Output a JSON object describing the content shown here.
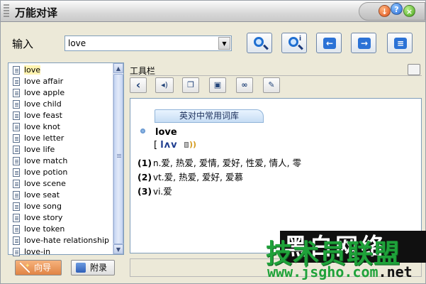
{
  "window": {
    "title": "万能对译",
    "controls": {
      "minimize": "↓",
      "help": "?",
      "close": "×"
    }
  },
  "input": {
    "label": "输入",
    "value": "love"
  },
  "word_list": {
    "items": [
      "love",
      "love affair",
      "love apple",
      "love child",
      "love feast",
      "love knot",
      "love letter",
      "love life",
      "love match",
      "love potion",
      "love scene",
      "love seat",
      "love song",
      "love story",
      "love token",
      "love-hate relationship",
      "love-in"
    ],
    "selected_index": 0
  },
  "bottom_buttons": {
    "wizard": "向导",
    "appendix": "附录"
  },
  "toolbar": {
    "title": "工具栏",
    "back_glyph": "‹"
  },
  "result": {
    "dictionary_tab": "英对中常用词库",
    "headword": "love",
    "phonetic_open": "[",
    "phonetic": "lʌv",
    "definitions": [
      {
        "num": "(1)",
        "pos": "n.",
        "text": "爱, 热爱, 爱情, 爱好, 性爱, 情人, 零"
      },
      {
        "num": "(2)",
        "pos": "vt.",
        "text": "爱, 热爱, 爱好, 爱慕"
      },
      {
        "num": "(3)",
        "pos": "vi.",
        "text": "爱"
      }
    ]
  },
  "watermark": {
    "dark_text": "黑白网络",
    "green_text": "技术员联盟",
    "url_main": "www.jsgho.com",
    "url_suffix": ".net"
  },
  "colors": {
    "wizard_bg": "#e08444",
    "selection": "#fff3b0",
    "watermark_green": "#1fa23a"
  }
}
